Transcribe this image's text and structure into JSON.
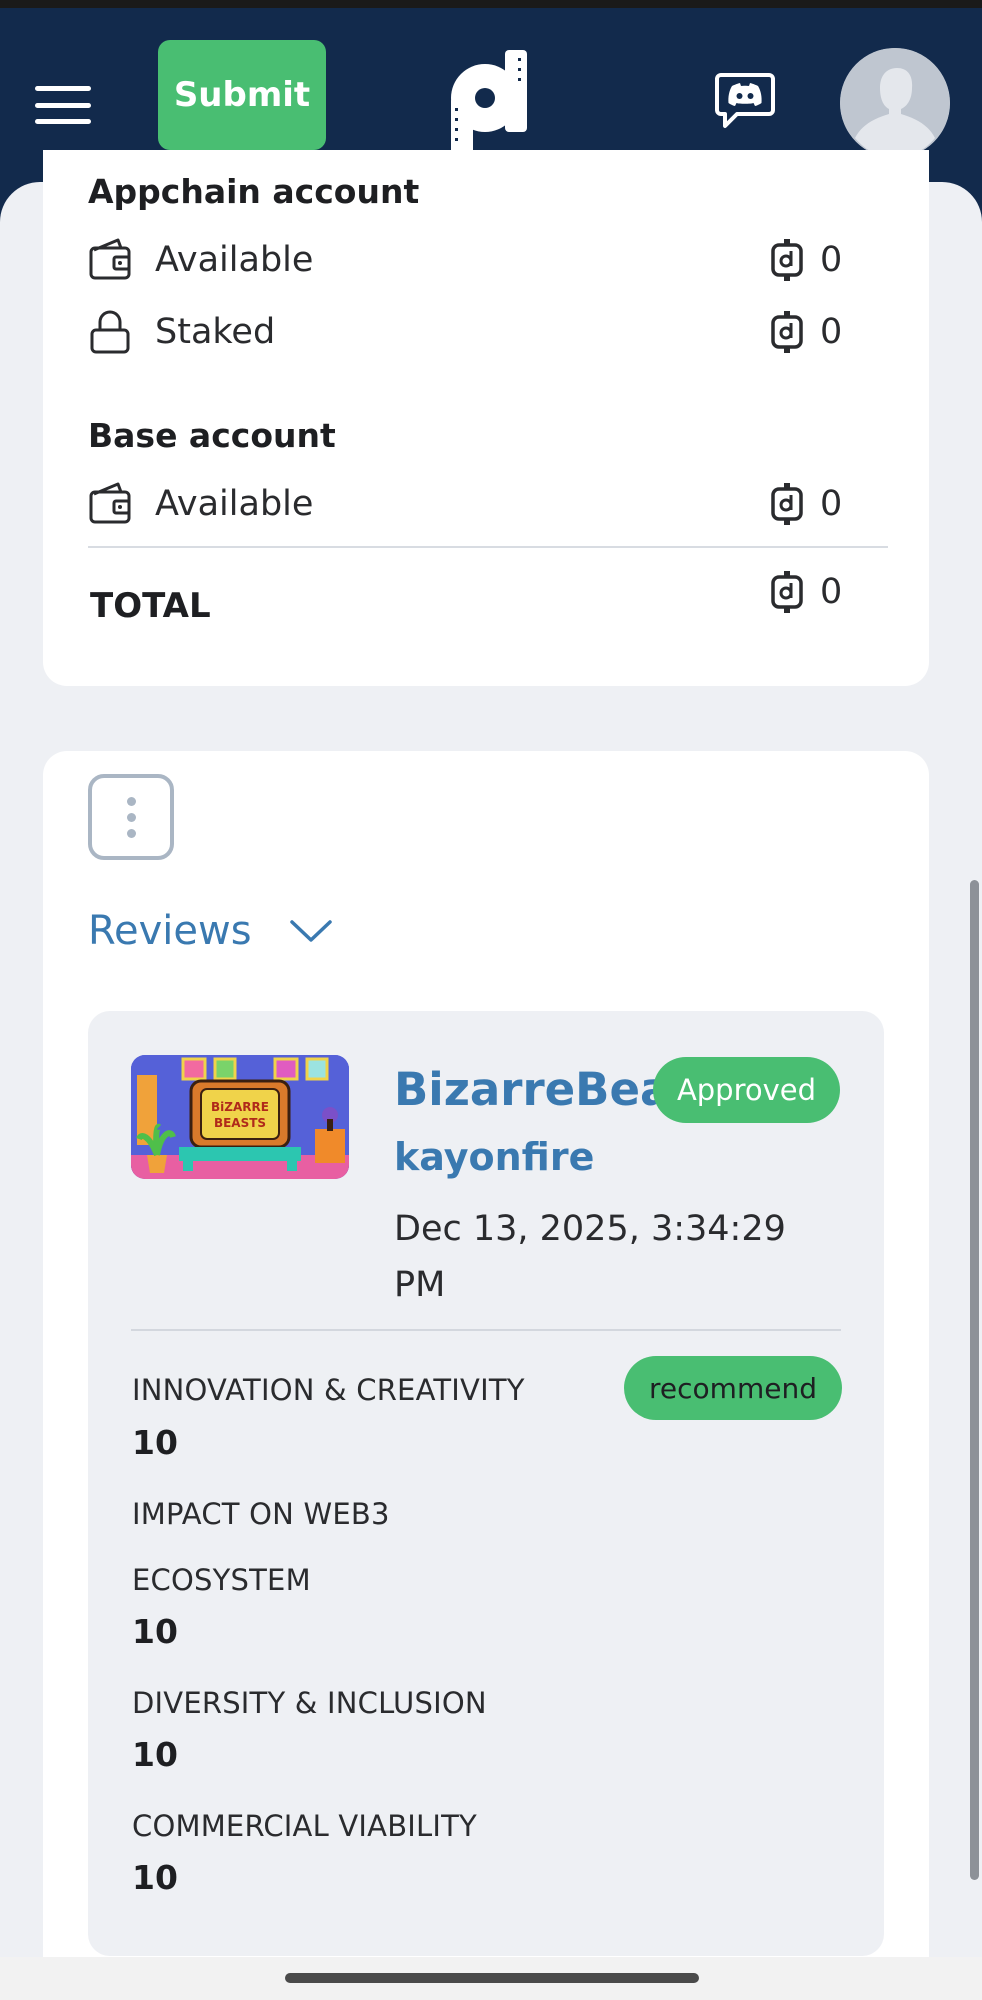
{
  "header": {
    "submit_label": "Submit",
    "logo_icon": "pd-logo-icon",
    "discord_icon": "discord-icon",
    "avatar_icon": "user-avatar-icon",
    "colors": {
      "bar": "#122a4c",
      "accent": "#49be72"
    }
  },
  "balances": {
    "appchain_title": "Appchain account",
    "appchain_rows": [
      {
        "icon": "wallet-icon",
        "label": "Available",
        "amount": "0"
      },
      {
        "icon": "lock-icon",
        "label": "Staked",
        "amount": "0"
      }
    ],
    "base_title": "Base account",
    "base_rows": [
      {
        "icon": "wallet-icon",
        "label": "Available",
        "amount": "0"
      }
    ],
    "total_label": "TOTAL",
    "total_amount": "0"
  },
  "reviews": {
    "toggle_label": "Reviews",
    "item": {
      "thumb_text": "BiZARRE BEASTS",
      "project_name": "BizarreBeasts",
      "status": "Approved",
      "reviewer": "kayonfire",
      "date": "Dec 13, 2025, 3:34:29 PM",
      "recommendation": "recommend",
      "criteria": [
        {
          "label": "INNOVATION & CREATIVITY",
          "score": "10"
        },
        {
          "label": "IMPACT ON WEB3",
          "score": ""
        },
        {
          "label": "ECOSYSTEM",
          "score": "10"
        },
        {
          "label": "DIVERSITY & INCLUSION",
          "score": "10"
        },
        {
          "label": "COMMERCIAL VIABILITY",
          "score": "10"
        }
      ]
    }
  }
}
